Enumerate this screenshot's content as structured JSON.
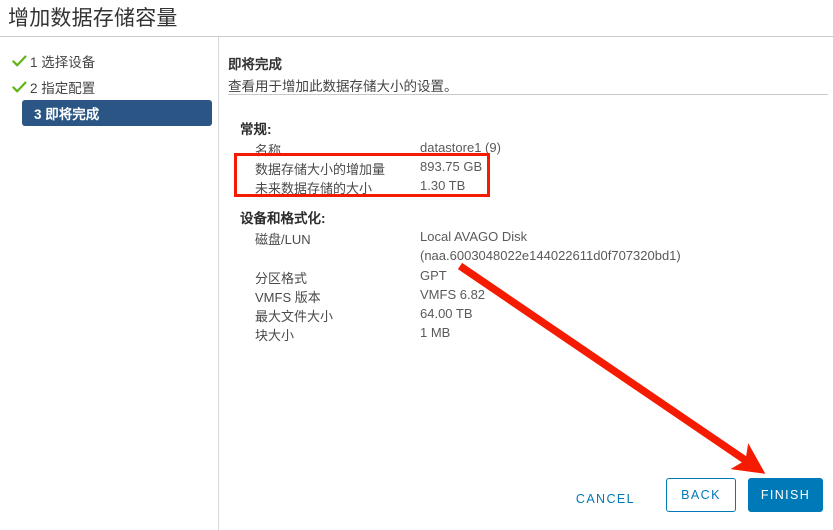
{
  "header": {
    "title": "增加数据存储容量"
  },
  "sidebar": {
    "steps": [
      {
        "number": "1",
        "label": "1 选择设备",
        "state": "completed",
        "icon": "check-icon"
      },
      {
        "number": "2",
        "label": "2 指定配置",
        "state": "completed",
        "icon": "check-icon"
      },
      {
        "number": "3",
        "label": "3 即将完成",
        "state": "active",
        "icon": "none"
      }
    ]
  },
  "content": {
    "heading": "即将完成",
    "subheading": "查看用于增加此数据存储大小的设置。",
    "sections": [
      {
        "title": "常规:",
        "rows": [
          {
            "label": "名称",
            "value": "datastore1 (9)"
          },
          {
            "label": "数据存储大小的增加量",
            "value": "893.75 GB"
          },
          {
            "label": "未来数据存储的大小",
            "value": "1.30 TB"
          }
        ]
      },
      {
        "title": "设备和格式化:",
        "rows": [
          {
            "label": "磁盘/LUN",
            "value": "Local AVAGO Disk"
          },
          {
            "label": "",
            "value": "(naa.6003048022e144022611d0f707320bd1)"
          },
          {
            "label": "分区格式",
            "value": "GPT"
          },
          {
            "label": "VMFS 版本",
            "value": "VMFS 6.82"
          },
          {
            "label": "最大文件大小",
            "value": "64.00 TB"
          },
          {
            "label": "块大小",
            "value": "1 MB"
          }
        ]
      }
    ]
  },
  "footer": {
    "cancel_label": "CANCEL",
    "back_label": "BACK",
    "finish_label": "FINISH"
  },
  "annotations": {
    "highlight_box_color": "#f51b00",
    "arrow_color": "#f51b00",
    "arrow_target": "finish-button"
  },
  "colors": {
    "accent_blue": "#0079b8",
    "active_step_navy": "#2a5584",
    "check_green": "#60b515",
    "annotation_red": "#f51b00"
  }
}
